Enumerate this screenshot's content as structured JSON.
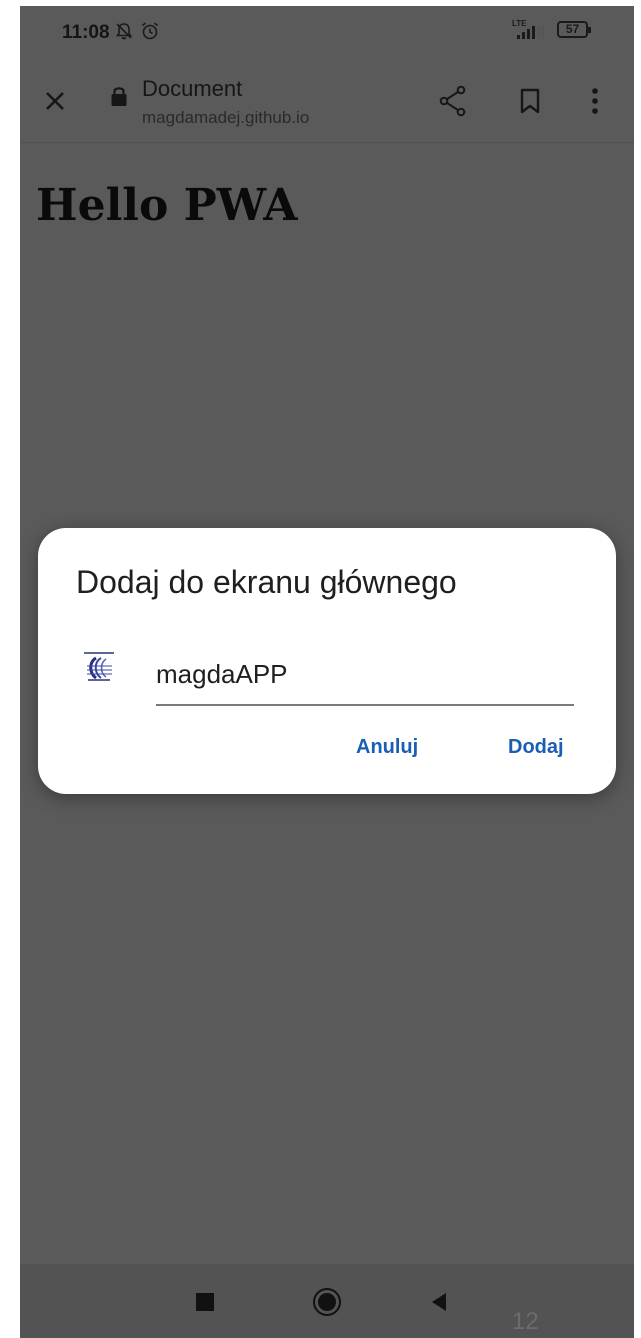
{
  "status_bar": {
    "time": "11:08",
    "network": "LTE",
    "battery": "57"
  },
  "toolbar": {
    "title": "Document",
    "url": "magdamadej.github.io"
  },
  "page": {
    "heading": "Hello PWA"
  },
  "dialog": {
    "title": "Dodaj do ekranu głównego",
    "app_name_value": "magdaAPP",
    "cancel_label": "Anuluj",
    "add_label": "Dodaj"
  },
  "footer": {
    "page_number": "12"
  },
  "colors": {
    "accent": "#1a5fb4",
    "scrim": "#5a5a5a",
    "dialog_bg": "#ffffff"
  },
  "icons": [
    "bell-off-icon",
    "alarm-icon",
    "signal-icon",
    "battery-icon",
    "close-icon",
    "lock-icon",
    "share-icon",
    "bookmark-icon",
    "more-icon",
    "app-icon",
    "recents-icon",
    "home-icon",
    "back-icon"
  ]
}
